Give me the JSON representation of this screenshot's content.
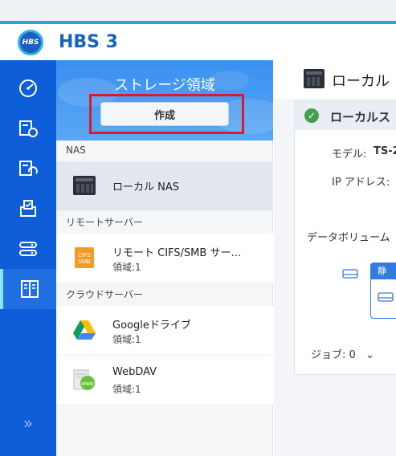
{
  "app": {
    "title": "HBS 3",
    "logo_text": "HBS"
  },
  "rail": {
    "items": [
      {
        "icon": "dashboard-icon"
      },
      {
        "icon": "backup-icon"
      },
      {
        "icon": "sync-icon"
      },
      {
        "icon": "restore-icon"
      },
      {
        "icon": "services-icon"
      },
      {
        "icon": "storage-spaces-icon",
        "active": true
      }
    ],
    "expand_label": "»"
  },
  "panel": {
    "banner_title": "ストレージ領域",
    "create_label": "作成",
    "sections": {
      "nas": "NAS",
      "remote": "リモートサーバー",
      "cloud": "クラウドサーバー"
    },
    "items": {
      "local_nas": {
        "name": "ローカル NAS"
      },
      "remote_cifs": {
        "name": "リモート CIFS/SMB サー…",
        "sub": "領域:1",
        "icon_text": "CIFS SMB"
      },
      "google_drive": {
        "name": "Googleドライブ",
        "sub": "領域:1"
      },
      "webdav": {
        "name": "WebDAV",
        "sub": "領域:1",
        "icon_text": "www"
      }
    }
  },
  "main": {
    "title": "ローカル",
    "card_title": "ローカルス",
    "model_label": "モデル:",
    "model_value": "TS-2",
    "ip_label": "IP アドレス:",
    "volumes_label": "データボリューム",
    "tag_label": "静",
    "jobs_label": "ジョブ: 0"
  },
  "colors": {
    "accent": "#1565c0",
    "rail": "#0d5ed8",
    "highlight": "#d81b2a"
  }
}
